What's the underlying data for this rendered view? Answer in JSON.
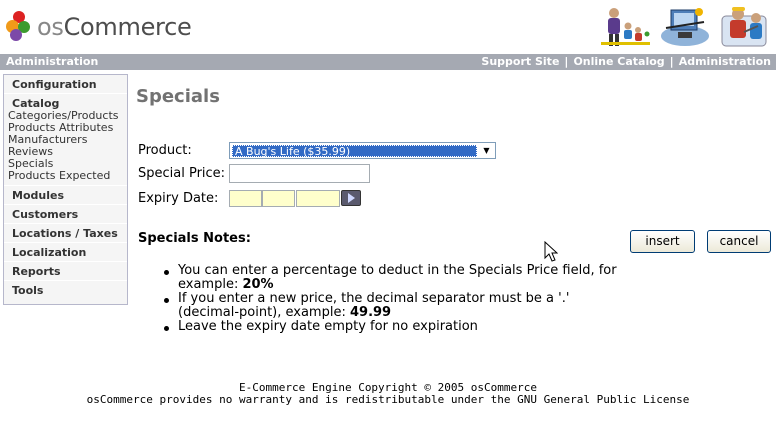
{
  "brand": {
    "wordmark_prefix": "os",
    "wordmark_suffix": "Commerce"
  },
  "header_icons": [
    "customers-icon",
    "catalog-icon",
    "support-icon"
  ],
  "topbar": {
    "left": "Administration",
    "links": [
      "Support Site",
      "Online Catalog",
      "Administration"
    ],
    "separator": "|"
  },
  "sidebar": {
    "configuration": "Configuration",
    "catalog": "Catalog",
    "catalog_items": [
      "Categories/Products",
      "Products Attributes",
      "Manufacturers",
      "Reviews",
      "Specials",
      "Products Expected"
    ],
    "modules": "Modules",
    "customers": "Customers",
    "locations": "Locations / Taxes",
    "localization": "Localization",
    "reports": "Reports",
    "tools": "Tools"
  },
  "page": {
    "title": "Specials"
  },
  "form": {
    "product_label": "Product:",
    "product_selected": "A Bug's Life ($35.99)",
    "special_price_label": "Special Price:",
    "special_price_value": "",
    "expiry_label": "Expiry Date:",
    "expiry_day": "",
    "expiry_month": "",
    "expiry_year": ""
  },
  "buttons": {
    "insert": "insert",
    "cancel": "cancel"
  },
  "notes": {
    "title": "Specials Notes:",
    "item1_text": "You can enter a percentage to deduct in the Specials Price field, for example: ",
    "item1_bold": "20%",
    "item2_text": "If you enter a new price, the decimal separator must be a '.' (decimal-point), example: ",
    "item2_bold": "49.99",
    "item3_text": "Leave the expiry date empty for no expiration"
  },
  "footer": {
    "line1": "E-Commerce Engine Copyright © 2005 osCommerce",
    "line2": "osCommerce provides no warranty and is redistributable under the GNU General Public License"
  },
  "colors": {
    "topbar": "#a5a9b2",
    "title": "#727272",
    "selection": "#316ac5",
    "date_field": "#ffffcc"
  }
}
